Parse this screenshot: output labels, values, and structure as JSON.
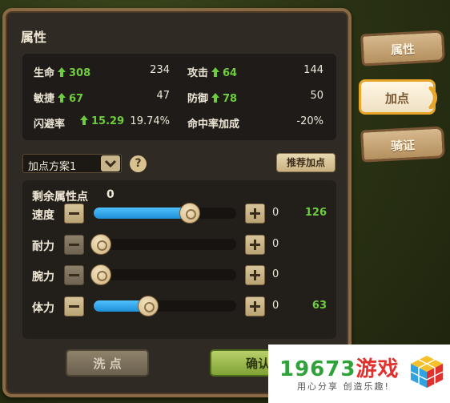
{
  "panel": {
    "title": "属性"
  },
  "stats": {
    "hp": {
      "label": "生命",
      "bonus": "308",
      "value": "234"
    },
    "attack": {
      "label": "攻击",
      "bonus": "64",
      "value": "144"
    },
    "agility": {
      "label": "敏捷",
      "bonus": "67",
      "value": "47"
    },
    "defense": {
      "label": "防御",
      "bonus": "78",
      "value": "50"
    },
    "dodge": {
      "label": "闪避率",
      "bonus": "15.29",
      "value": "19.74%"
    },
    "hit": {
      "label": "命中率加成",
      "value": "-20%"
    }
  },
  "plan": {
    "selected": "加点方案1",
    "help": "?",
    "recommend_label": "推荐加点"
  },
  "allocation": {
    "remaining_label": "剩余属性点",
    "remaining_value": "0",
    "rows": [
      {
        "label": "速度",
        "added": "0",
        "total": "126",
        "fill": 0.66
      },
      {
        "label": "耐力",
        "added": "0",
        "total": "",
        "fill": 0.0
      },
      {
        "label": "腕力",
        "added": "0",
        "total": "",
        "fill": 0.0
      },
      {
        "label": "体力",
        "added": "0",
        "total": "63",
        "fill": 0.35
      }
    ]
  },
  "buttons": {
    "wash": "洗 点",
    "confirm": "确认加点"
  },
  "tabs": [
    {
      "label": "属性",
      "active": false
    },
    {
      "label": "加点",
      "active": true
    },
    {
      "label": "骑证",
      "active": false
    }
  ],
  "watermark": {
    "number": "19673",
    "name": "游戏",
    "slogan": "用心分享  创造乐趣!"
  },
  "colors": {
    "bonus_green": "#6fcc3c",
    "slider_blue": "#2aa4ee",
    "tab_highlight": "#e7a52a"
  }
}
